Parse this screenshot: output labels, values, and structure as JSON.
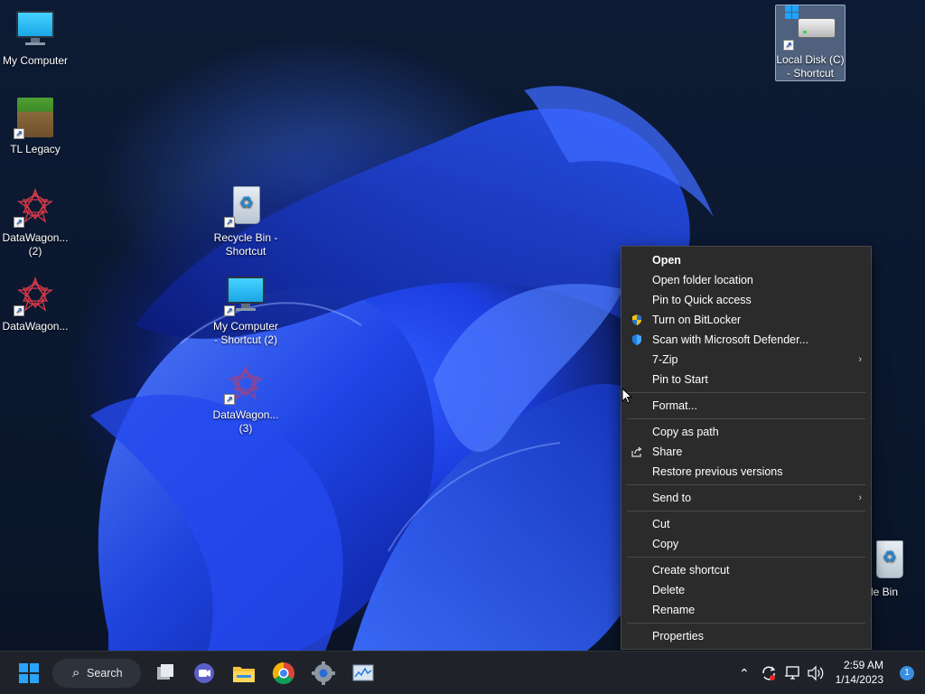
{
  "desktop": {
    "icons": [
      {
        "label": "My Computer"
      },
      {
        "label": "TL Legacy"
      },
      {
        "label": "DataWagon... (2)"
      },
      {
        "label": "DataWagon..."
      },
      {
        "label": "Recycle Bin - Shortcut"
      },
      {
        "label": "My Computer - Shortcut (2)"
      },
      {
        "label": "DataWagon... (3)"
      },
      {
        "label": "Local Disk (C) - Shortcut"
      },
      {
        "label": "ycle Bin"
      }
    ]
  },
  "context_menu": {
    "items": [
      {
        "label": "Open",
        "bold": true
      },
      {
        "label": "Open folder location"
      },
      {
        "label": "Pin to Quick access"
      },
      {
        "label": "Turn on BitLocker",
        "icon": "shield-icon"
      },
      {
        "label": "Scan with Microsoft Defender...",
        "icon": "defender-icon"
      },
      {
        "label": "7-Zip",
        "submenu": true
      },
      {
        "label": "Pin to Start"
      },
      {
        "label": "Format..."
      },
      {
        "label": "Copy as path"
      },
      {
        "label": "Share",
        "icon": "share-icon"
      },
      {
        "label": "Restore previous versions"
      },
      {
        "label": "Send to",
        "submenu": true
      },
      {
        "label": "Cut"
      },
      {
        "label": "Copy"
      },
      {
        "label": "Create shortcut"
      },
      {
        "label": "Delete"
      },
      {
        "label": "Rename"
      },
      {
        "label": "Properties"
      }
    ]
  },
  "taskbar": {
    "search_label": "Search",
    "apps": [
      "start-icon",
      "task-view-icon",
      "chat-icon",
      "file-explorer-icon",
      "chrome-icon",
      "settings-icon",
      "resource-monitor-icon"
    ],
    "clock_time": "2:59 AM",
    "clock_date": "1/14/2023",
    "notification_count": "1"
  },
  "colors": {
    "menu_bg": "#2b2b2b",
    "taskbar_bg": "#1f2329",
    "accent": "#1fa3ff"
  }
}
